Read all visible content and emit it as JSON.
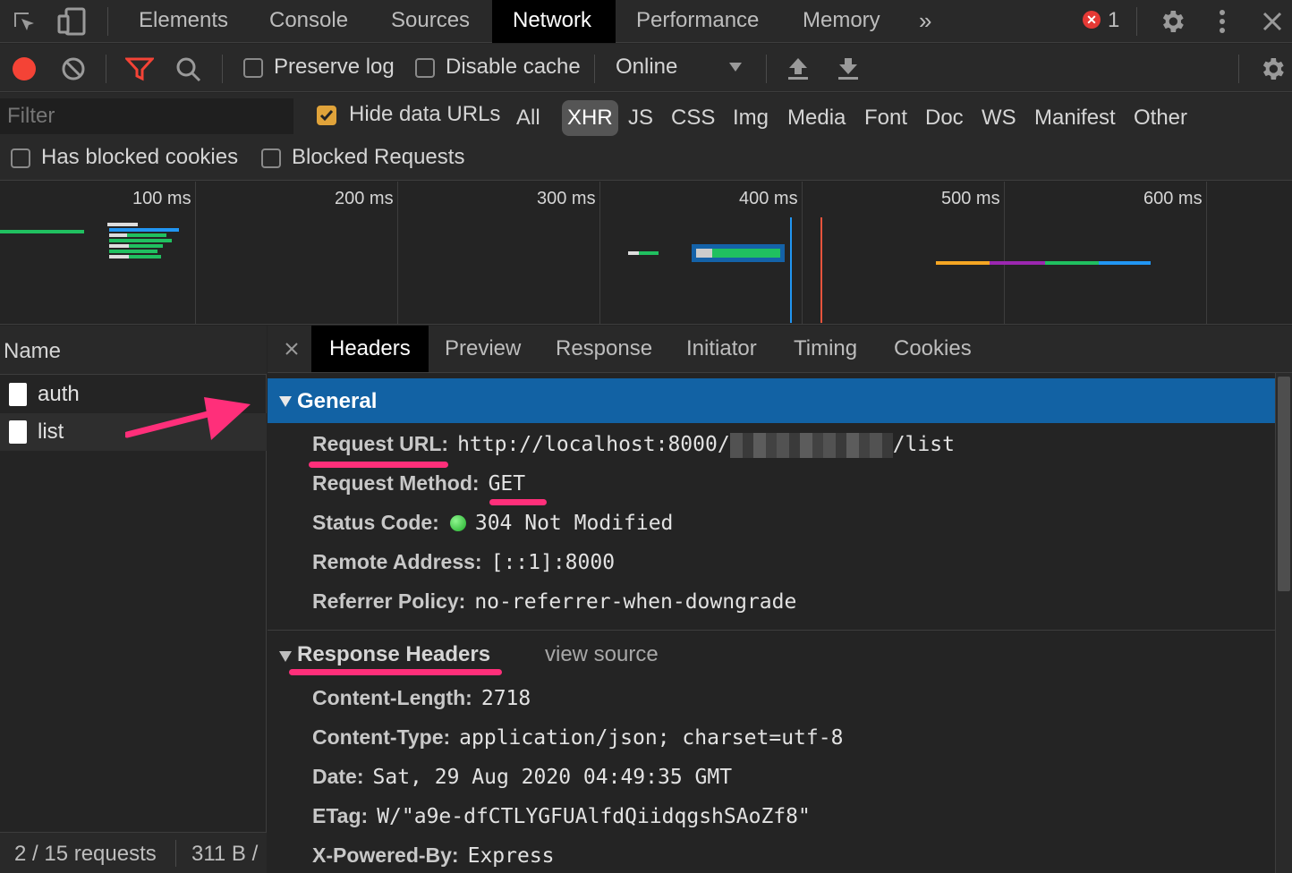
{
  "tabs": [
    "Elements",
    "Console",
    "Sources",
    "Network",
    "Performance",
    "Memory"
  ],
  "active_tab": "Network",
  "more_tabs_glyph": "»",
  "error_count": "1",
  "toolbar": {
    "preserve_log": "Preserve log",
    "disable_cache": "Disable cache",
    "throttle": "Online"
  },
  "filter": {
    "placeholder": "Filter",
    "hide_data_urls": "Hide data URLs",
    "types": [
      "All",
      "XHR",
      "JS",
      "CSS",
      "Img",
      "Media",
      "Font",
      "Doc",
      "WS",
      "Manifest",
      "Other"
    ],
    "active_type": "XHR",
    "has_blocked_cookies": "Has blocked cookies",
    "blocked_requests": "Blocked Requests"
  },
  "overview": {
    "ticks": [
      "100 ms",
      "200 ms",
      "300 ms",
      "400 ms",
      "500 ms",
      "600 ms"
    ]
  },
  "name_panel": {
    "header": "Name",
    "rows": [
      "auth",
      "list"
    ],
    "status_requests": "2 / 15 requests",
    "status_size": "311 B /"
  },
  "detail_tabs": [
    "Headers",
    "Preview",
    "Response",
    "Initiator",
    "Timing",
    "Cookies"
  ],
  "active_detail_tab": "Headers",
  "general": {
    "title": "General",
    "request_url_key": "Request URL:",
    "request_url_prefix": "http://localhost:8000/",
    "request_url_suffix": "/list",
    "request_method_key": "Request Method:",
    "request_method": "GET",
    "status_code_key": "Status Code:",
    "status_code": "304 Not Modified",
    "remote_address_key": "Remote Address:",
    "remote_address": "[::1]:8000",
    "referrer_policy_key": "Referrer Policy:",
    "referrer_policy": "no-referrer-when-downgrade"
  },
  "response_headers": {
    "title": "Response Headers",
    "view_source": "view source",
    "items": [
      {
        "k": "Content-Length:",
        "v": "2718"
      },
      {
        "k": "Content-Type:",
        "v": "application/json; charset=utf-8"
      },
      {
        "k": "Date:",
        "v": "Sat, 29 Aug 2020 04:49:35 GMT"
      },
      {
        "k": "ETag:",
        "v": "W/\"a9e-dfCTLYGFUAlfdQiidqgshSAoZf8\""
      },
      {
        "k": "X-Powered-By:",
        "v": "Express"
      }
    ]
  },
  "colors": {
    "accent_pink": "#ff2f7a",
    "record_red": "#f44336",
    "general_bar": "#1262a4",
    "status_green": "#2ecc40"
  }
}
